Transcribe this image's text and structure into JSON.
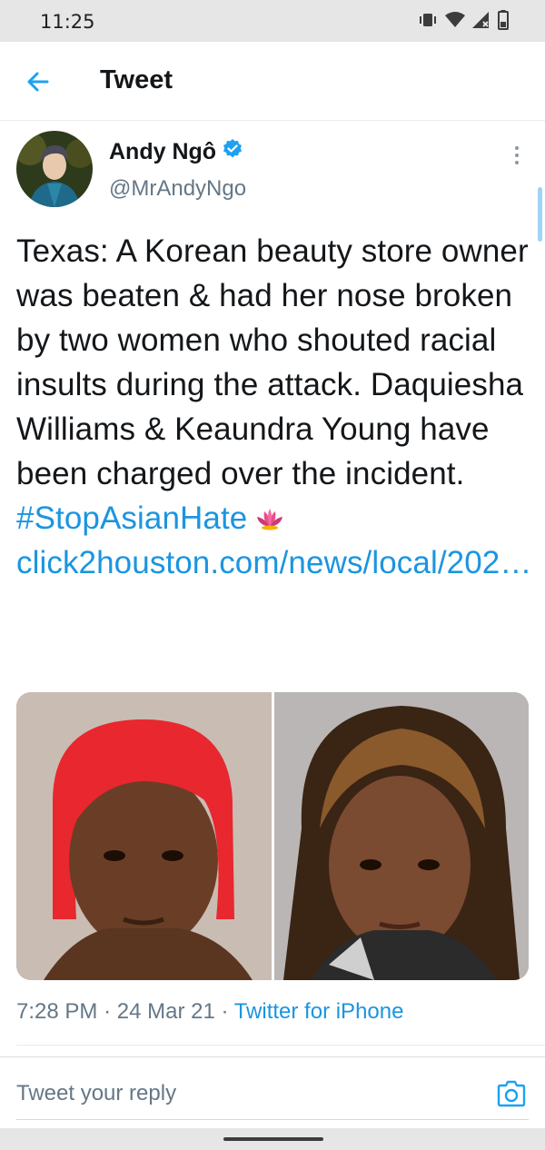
{
  "status_bar": {
    "time": "11:25"
  },
  "header": {
    "title": "Tweet"
  },
  "tweet": {
    "author_name": "Andy Ngô",
    "author_handle": "@MrAndyNgo",
    "text_part1": "Texas: A Korean beauty store owner was beaten & had her nose broken by two women who shouted racial insults during the attack. Daquiesha Williams & Keaundra Young have been charged over the incident. ",
    "hashtag": "#StopAsianHate",
    "link": "click2houston.com/news/local/202…",
    "time": "7:28 PM",
    "date": "24 Mar 21",
    "separator": "·",
    "source": "Twitter for iPhone"
  },
  "reply": {
    "placeholder": "Tweet your reply"
  },
  "colors": {
    "link": "#1b95e0",
    "verified": "#1da1f2",
    "secondary": "#657786"
  },
  "icons": [
    "back-arrow-icon",
    "verified-badge-icon",
    "more-vertical-icon",
    "lotus-emoji-icon",
    "camera-icon",
    "vibrate-icon",
    "wifi-icon",
    "signal-icon",
    "battery-icon"
  ]
}
